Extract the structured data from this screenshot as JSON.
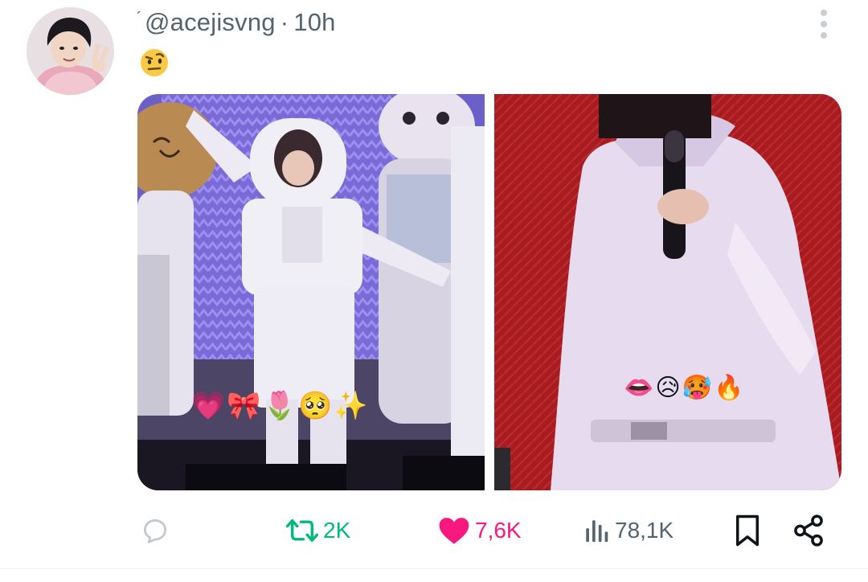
{
  "tweet": {
    "header_mark": "´",
    "handle": "@acejisvng",
    "separator": "·",
    "time": "10h",
    "text_emoji": "🤨",
    "media": [
      {
        "overlay_emojis": "💗🎀🌷🥺✨"
      },
      {
        "overlay_emojis": "👄😥🥵🔥"
      }
    ]
  },
  "actions": {
    "reply_icon": "reply-icon",
    "retweet_count": "2K",
    "like_count": "7,6K",
    "views_count": "78,1K",
    "bookmark_icon": "bookmark-icon",
    "share_icon": "share-icon"
  },
  "colors": {
    "muted": "#536471",
    "retweet": "#00ba7c",
    "like": "#f91880"
  }
}
